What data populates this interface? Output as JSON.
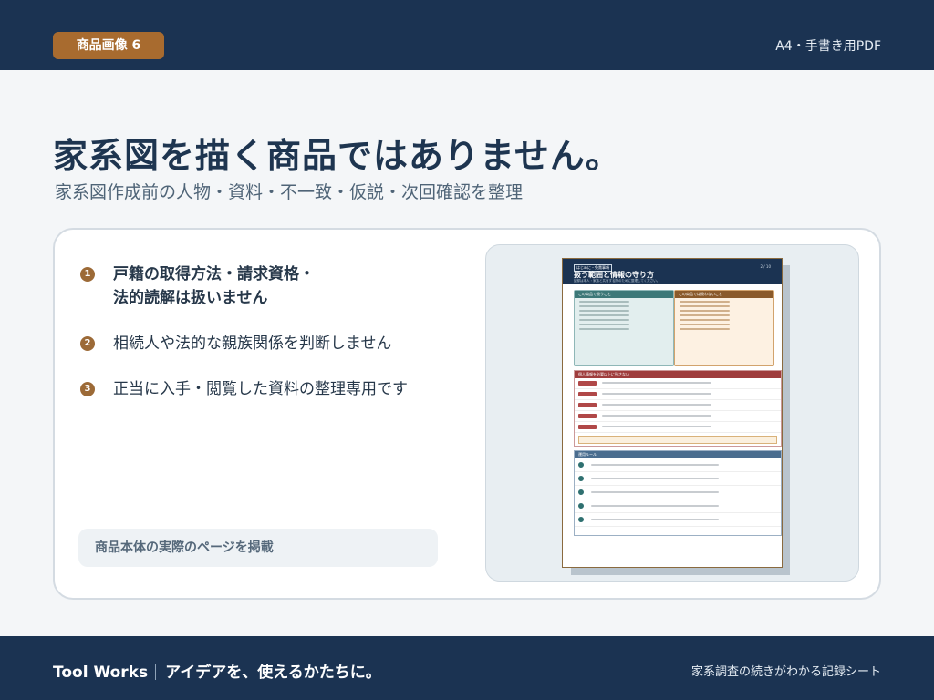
{
  "header": {
    "badge_label": "商品画像 6",
    "format_label": "A4・手書き用PDF"
  },
  "hero": {
    "title": "家系図を描く商品ではありません。",
    "subtitle": "家系図作成前の人物・資料・不一致・仮説・次回確認を整理"
  },
  "notes": {
    "items": [
      {
        "number": "1",
        "line1": "戸籍の取得方法・請求資格・",
        "line2": "法的読解は扱いません"
      },
      {
        "number": "2",
        "line1": "相続人や法的な親族関係を判断しません"
      },
      {
        "number": "3",
        "line1": "正当に入手・閲覧した資料の整理専用です"
      }
    ],
    "caption": "商品本体の実際のページを掲載"
  },
  "preview": {
    "page_title": "扱う範囲と情報の守り方",
    "tag": "はじめに・免責事項",
    "page_number": "2 / 10",
    "subtitle": "記録は本人・家族と共有する際のために整理してください。",
    "left_column": "この商品で扱うこと",
    "right_column": "この商品では扱わないこと",
    "section_personal": "個人情報を必要以上に残さない",
    "section_rules": "運用ルール"
  },
  "footer": {
    "brand": "Tool Works",
    "tagline": "アイデアを、使えるかたちに。",
    "product": "家系調査の続きがわかる記録シート"
  }
}
